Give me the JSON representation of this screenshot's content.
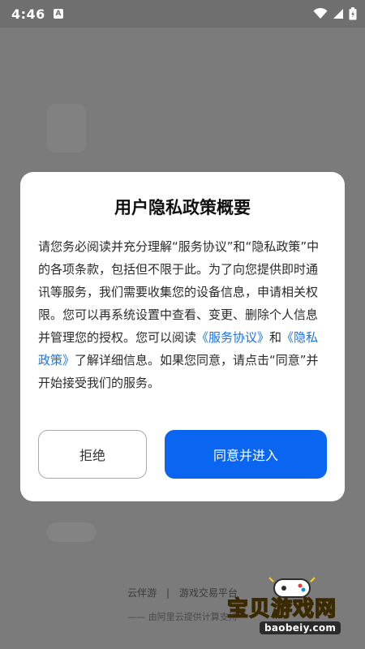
{
  "status_bar": {
    "time": "4:46",
    "notification_icon_letter": "A",
    "icons": [
      "wifi-icon",
      "signal-icon",
      "battery-icon"
    ]
  },
  "dialog": {
    "title": "用户隐私政策概要",
    "body_part1": "请您务必阅读并充分理解“服务协议”和“隐私政策”中的各项条款，包括但不限于此。为了向您提供即时通讯等服务，我们需要收集您的设备信息，申请相关权限。您可以再系统设置中查看、变更、删除个人信息并管理您的授权。您可以阅读",
    "link_service": "《服务协议》",
    "body_and": "和",
    "link_privacy": "《隐私政策》",
    "body_part2": "了解详细信息。如果您同意，请点击“同意”并开始接受我们的服务。",
    "reject_label": "拒绝",
    "accept_label": "同意并进入"
  },
  "footer": {
    "brand_left": "云伴游",
    "separator": "|",
    "brand_right": "游戏交易平台",
    "sub": "—— 由阿里云提供计算支持"
  },
  "watermark": {
    "text": "宝贝游戏网",
    "url": "baobeiy.com"
  },
  "colors": {
    "accent": "#0a66f0",
    "link": "#1a73e8",
    "watermark": "#ffd21f"
  }
}
